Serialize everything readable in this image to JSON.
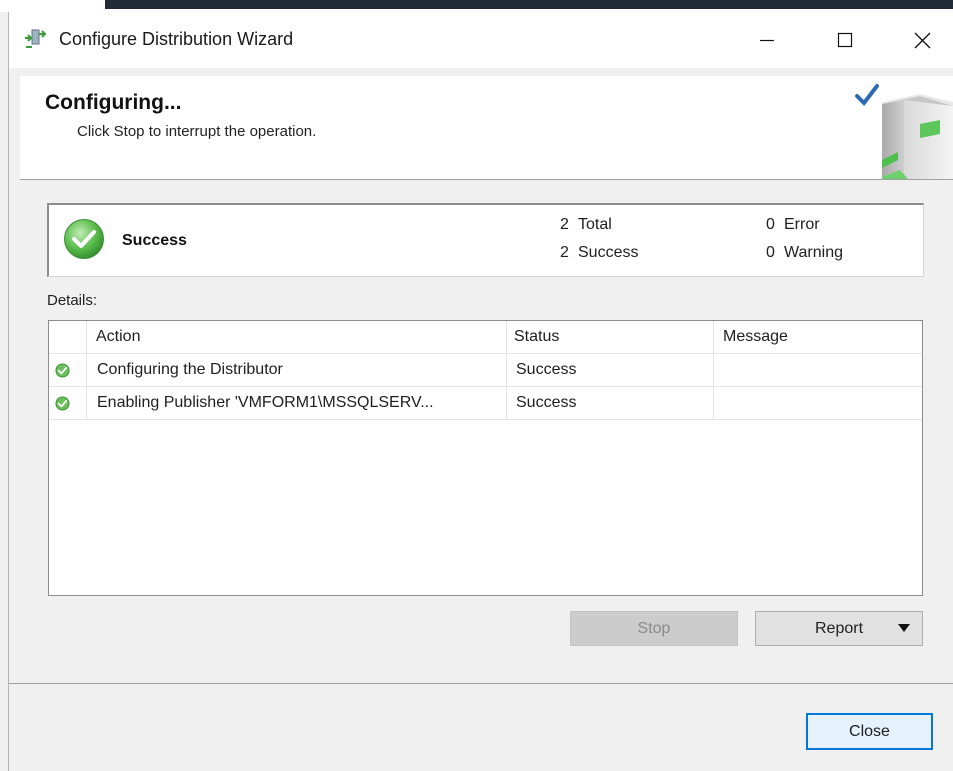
{
  "window": {
    "title": "Configure Distribution Wizard"
  },
  "header": {
    "title": "Configuring...",
    "subtitle": "Click Stop to interrupt the operation."
  },
  "summary": {
    "status": "Success",
    "total_count": "2",
    "total_label": "Total",
    "success_count": "2",
    "success_label": "Success",
    "error_count": "0",
    "error_label": "Error",
    "warning_count": "0",
    "warning_label": "Warning"
  },
  "details": {
    "label": "Details:",
    "columns": {
      "action": "Action",
      "status": "Status",
      "message": "Message"
    },
    "rows": [
      {
        "action": "Configuring the Distributor",
        "status": "Success",
        "message": "",
        "icon": "success-check-icon"
      },
      {
        "action": "Enabling Publisher 'VMFORM1\\MSSQLSERV...",
        "status": "Success",
        "message": "",
        "icon": "success-check-icon"
      }
    ]
  },
  "buttons": {
    "stop": "Stop",
    "report": "Report",
    "close": "Close"
  },
  "colors": {
    "accent": "#0078d7",
    "success": "#4caf50",
    "disabled_button": "#cccccc"
  }
}
